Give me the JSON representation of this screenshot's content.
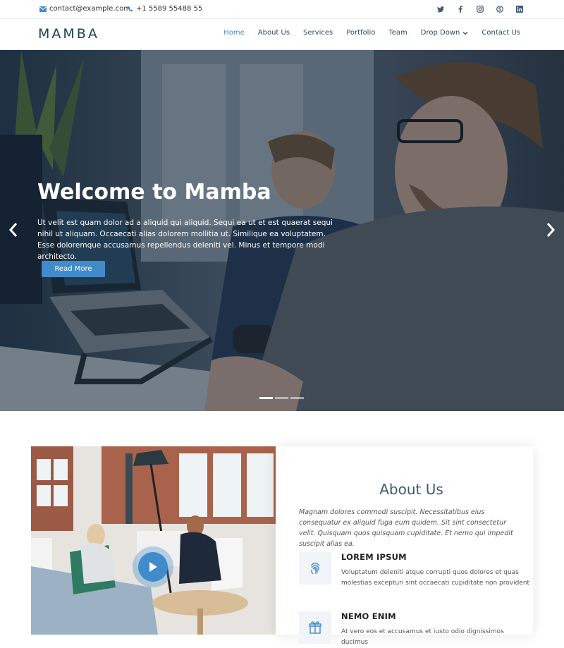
{
  "topbar": {
    "email": "contact@example.com",
    "phone": "+1 5589 55488 55",
    "social_icons": [
      "twitter-icon",
      "facebook-icon",
      "instagram-icon",
      "skype-icon",
      "linkedin-icon"
    ]
  },
  "header": {
    "logo": "MAMBA",
    "nav": {
      "home": "Home",
      "about": "About Us",
      "services": "Services",
      "portfolio": "Portfolio",
      "team": "Team",
      "dropdown": "Drop Down",
      "contact": "Contact Us"
    }
  },
  "hero": {
    "title": "Welcome to Mamba",
    "text": "Ut velit est quam dolor ad a aliquid qui aliquid. Sequi ea ut et est quaerat sequi nihil ut aliquam. Occaecati alias dolorem mollitia ut. Similique ea voluptatem. Esse doloremque accusamus repellendus deleniti vel. Minus et tempore modi architecto.",
    "button": "Read More",
    "slides": 3,
    "active_slide": 1
  },
  "about": {
    "title": "About Us",
    "intro": "Magnam dolores commodi suscipit. Necessitatibus eius consequatur ex aliquid fuga eum quidem. Sit sint consectetur velit. Quisquam quos quisquam cupiditate. Et nemo qui impedit suscipit alias ea.",
    "features": [
      {
        "icon": "fingerprint-icon",
        "title": "LOREM IPSUM",
        "text": "Voluptatum deleniti atque corrupti quos dolores et quas molestias excepturi sint occaecati cupiditate non provident"
      },
      {
        "icon": "gift-icon",
        "title": "NEMO ENIM",
        "text": "At vero eos et accusamus et iusto odio dignissimos ducimus"
      }
    ]
  },
  "colors": {
    "accent": "#428bca",
    "logo": "#1e4356",
    "heading": "#3c5a70"
  }
}
